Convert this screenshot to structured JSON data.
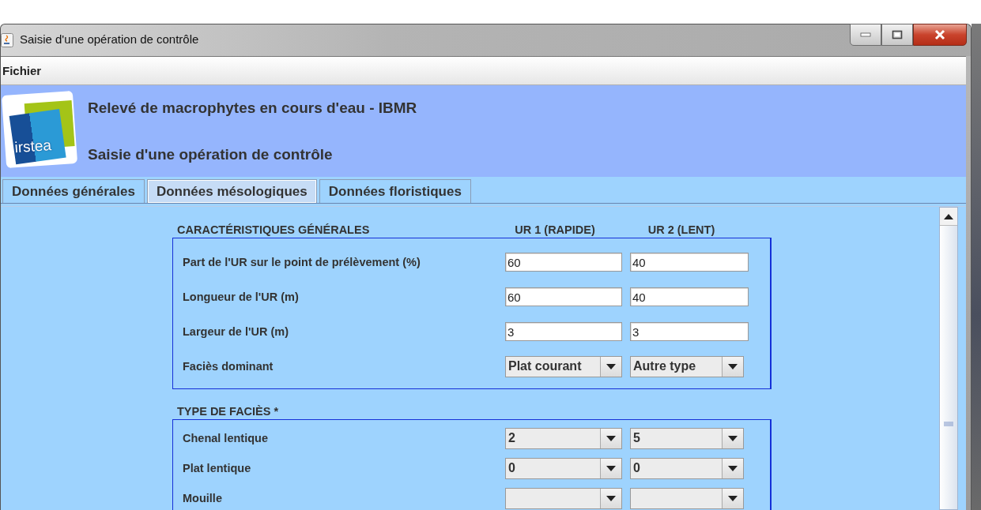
{
  "window": {
    "title": "Saisie d'une opération de contrôle"
  },
  "menu": [
    "Fichier"
  ],
  "header": {
    "logo_text": "irstea",
    "title": "Relevé de macrophytes en cours d'eau - IBMR",
    "subtitle": "Saisie d'une opération de contrôle"
  },
  "tabs": [
    {
      "label": "Données générales",
      "selected": false
    },
    {
      "label": "Données mésologiques",
      "selected": true
    },
    {
      "label": "Données floristiques",
      "selected": false
    }
  ],
  "sections": [
    {
      "title": "CARACTÉRISTIQUES GÉNÉRALES",
      "columns": [
        "UR 1 (RAPIDE)",
        "UR 2 (LENT)"
      ],
      "rows": [
        {
          "label": "Part de l'UR sur le point de prélèvement (%)",
          "kind": "text",
          "values": [
            "60",
            "40"
          ]
        },
        {
          "label": "Longueur de l'UR (m)",
          "kind": "text",
          "values": [
            "60",
            "40"
          ]
        },
        {
          "label": "Largeur de l'UR (m)",
          "kind": "text",
          "values": [
            "3",
            "3"
          ]
        },
        {
          "label": "Faciès dominant",
          "kind": "select",
          "values": [
            "Plat courant",
            "Autre type"
          ]
        }
      ]
    },
    {
      "title": "TYPE DE FACIÈS *",
      "rows": [
        {
          "label": "Chenal lentique",
          "kind": "select",
          "values": [
            "2",
            "5"
          ]
        },
        {
          "label": "Plat lentique",
          "kind": "select",
          "values": [
            "0",
            "0"
          ]
        },
        {
          "label": "Mouille",
          "kind": "select"
        }
      ]
    }
  ]
}
